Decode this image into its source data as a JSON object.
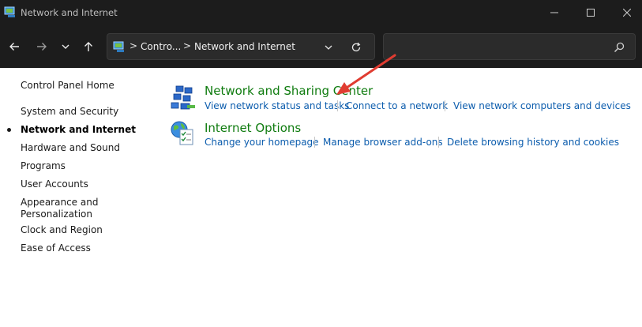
{
  "window": {
    "title": "Network and Internet",
    "controls": {
      "minimize_icon": "minimize-icon",
      "maximize_icon": "maximize-icon",
      "close_icon": "close-icon"
    }
  },
  "nav": {
    "breadcrumbs": [
      "Contro...",
      "Network and Internet"
    ],
    "separator": ">",
    "search": {
      "value": "",
      "placeholder": ""
    }
  },
  "sidebar": {
    "home": "Control Panel Home",
    "items": [
      {
        "label": "System and Security",
        "active": false
      },
      {
        "label": "Network and Internet",
        "active": true
      },
      {
        "label": "Hardware and Sound",
        "active": false
      },
      {
        "label": "Programs",
        "active": false
      },
      {
        "label": "User Accounts",
        "active": false
      },
      {
        "label": "Appearance and",
        "label2": "Personalization",
        "active": false
      },
      {
        "label": "Clock and Region",
        "active": false
      },
      {
        "label": "Ease of Access",
        "active": false
      }
    ]
  },
  "categories": [
    {
      "title": "Network and Sharing Center",
      "icon": "network-sharing-icon",
      "links": [
        "View network status and tasks",
        "Connect to a network",
        "View network computers and devices"
      ]
    },
    {
      "title": "Internet Options",
      "icon": "internet-options-icon",
      "links": [
        "Change your homepage",
        "Manage browser add-ons",
        "Delete browsing history and cookies"
      ]
    }
  ],
  "colors": {
    "titlebar_bg": "#1c1c1c",
    "category_title": "#107c10",
    "link": "#0b5cad",
    "annotation_arrow": "#e03c31"
  }
}
